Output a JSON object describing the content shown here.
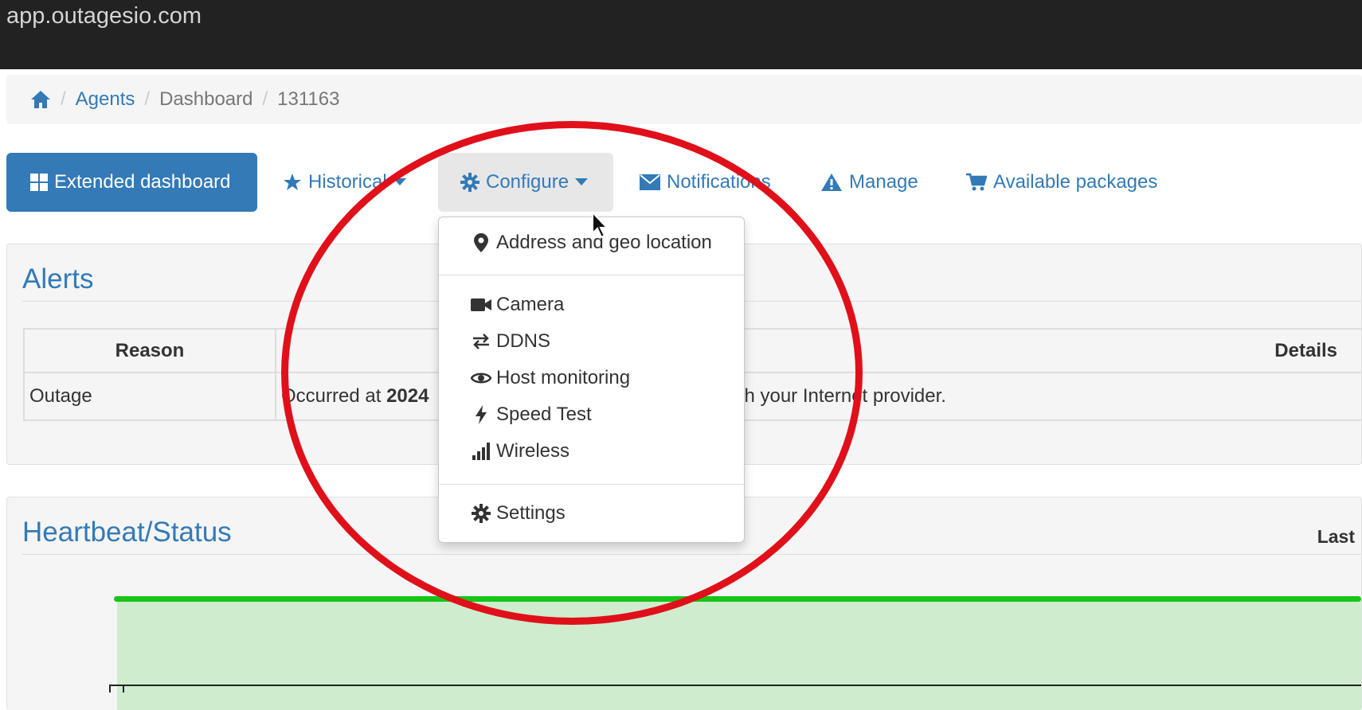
{
  "browser": {
    "url": "app.outagesio.com"
  },
  "breadcrumb": {
    "agents": "Agents",
    "dashboard": "Dashboard",
    "agent_id": "131163"
  },
  "nav": {
    "extended": "Extended dashboard",
    "historical": "Historical",
    "configure": "Configure",
    "notifications": "Notifications",
    "manage": "Manage",
    "packages": "Available packages"
  },
  "configure_menu": {
    "address": "Address and geo location",
    "camera": "Camera",
    "ddns": "DDNS",
    "host": "Host monitoring",
    "speed": "Speed Test",
    "wireless": "Wireless",
    "settings": "Settings"
  },
  "alerts": {
    "title": "Alerts",
    "columns": {
      "reason": "Reason",
      "details": "Details"
    },
    "row": {
      "reason": "Outage",
      "occurred_prefix": "Occurred at",
      "occurred_date": "2024",
      "details_tail": "with your Internet provider."
    }
  },
  "heartbeat": {
    "title": "Heartbeat/Status",
    "range_label": "Last"
  },
  "colors": {
    "brand": "#337ab7",
    "topbar": "#222222",
    "status_up_line": "#19c419",
    "status_up_fill": "#cfeccf",
    "highlight_circle": "#e0101a"
  }
}
